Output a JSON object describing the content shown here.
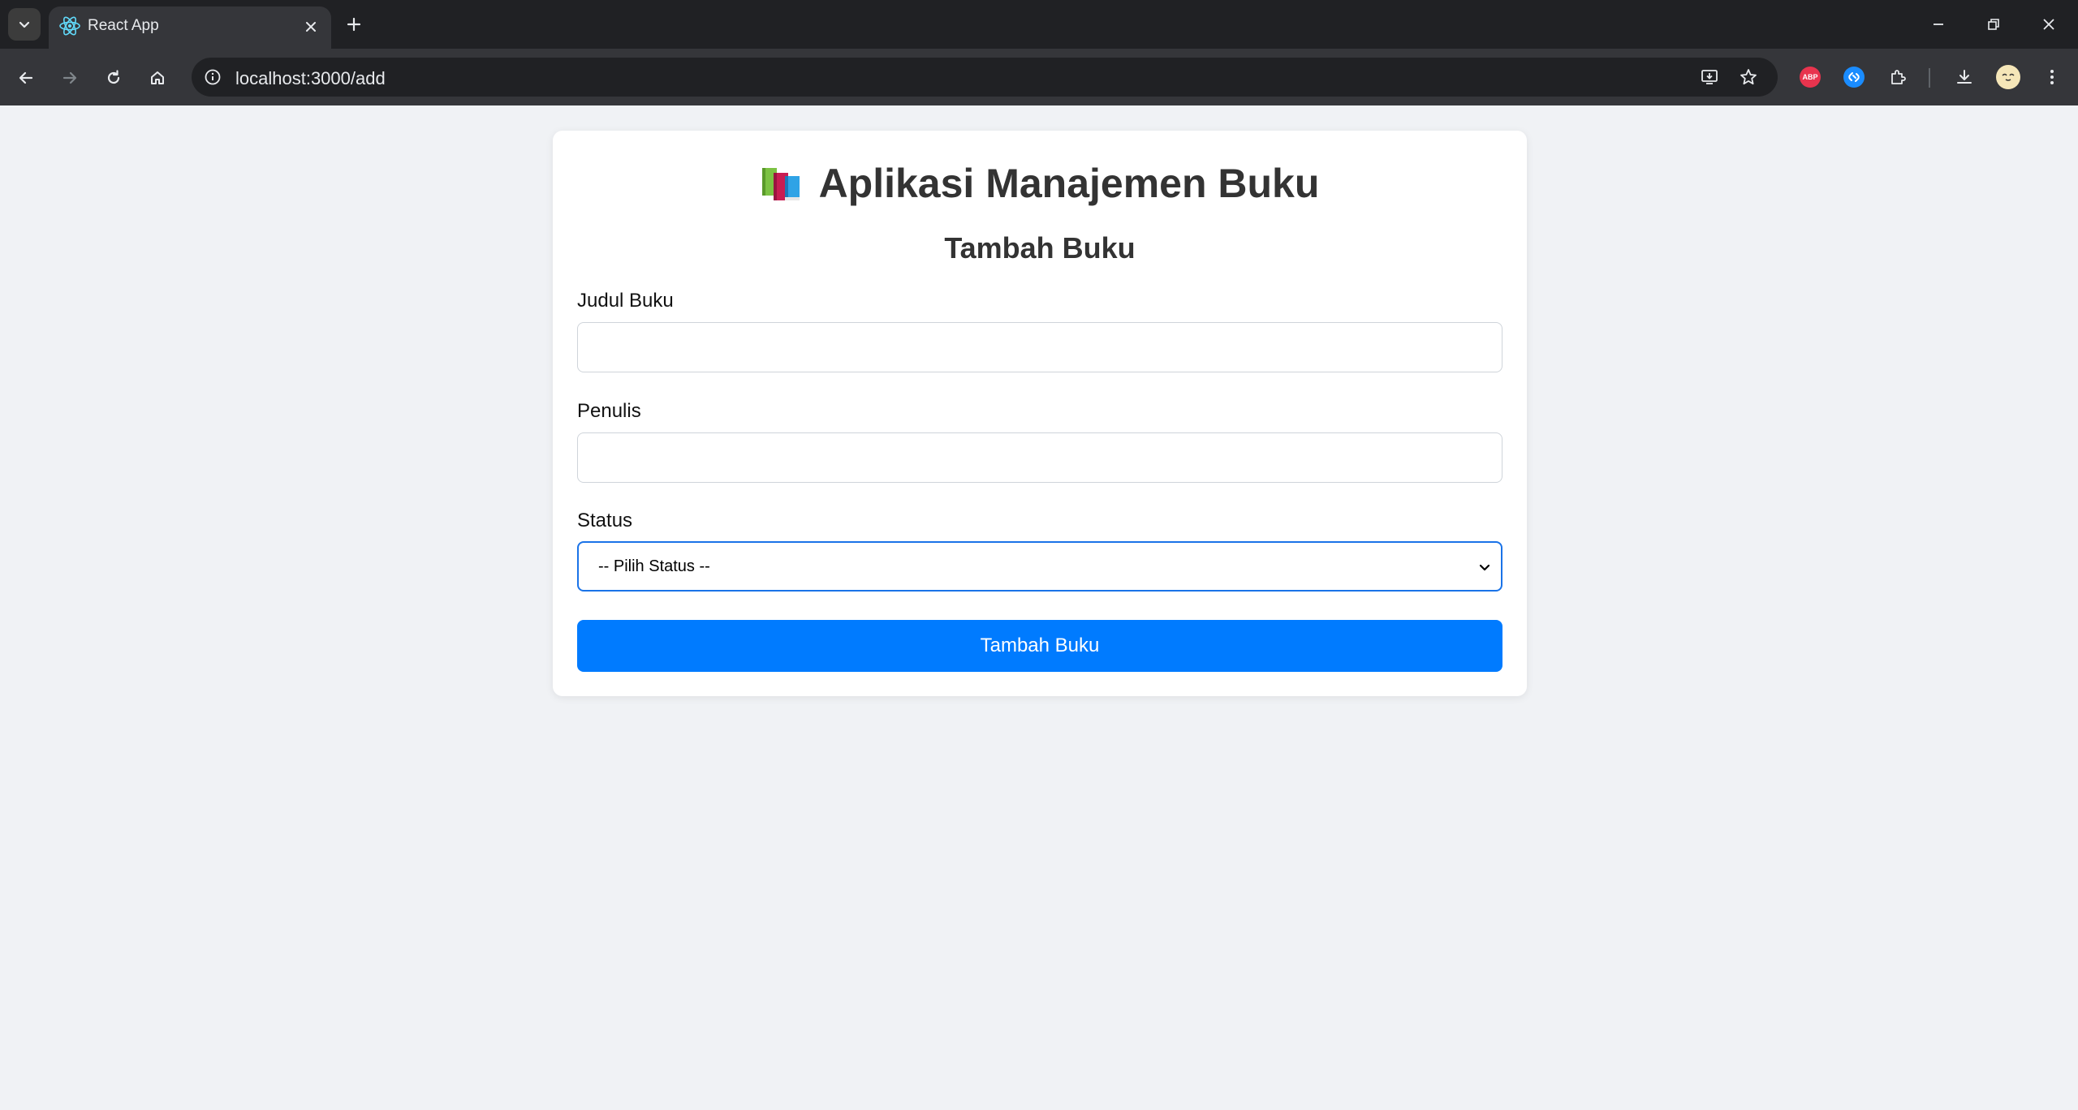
{
  "browser": {
    "tab_title": "React App",
    "url": "localhost:3000/add",
    "extensions": {
      "adblock_label": "ABP"
    }
  },
  "app": {
    "title": "Aplikasi Manajemen Buku",
    "subtitle": "Tambah Buku"
  },
  "form": {
    "title_label": "Judul Buku",
    "title_value": "",
    "author_label": "Penulis",
    "author_value": "",
    "status_label": "Status",
    "status_selected": "-- Pilih Status --",
    "submit_label": "Tambah Buku"
  },
  "colors": {
    "page_bg": "#f0f2f5",
    "card_bg": "#ffffff",
    "primary": "#007bff",
    "focus_border": "#1a73e8",
    "heading_text": "#333333"
  }
}
